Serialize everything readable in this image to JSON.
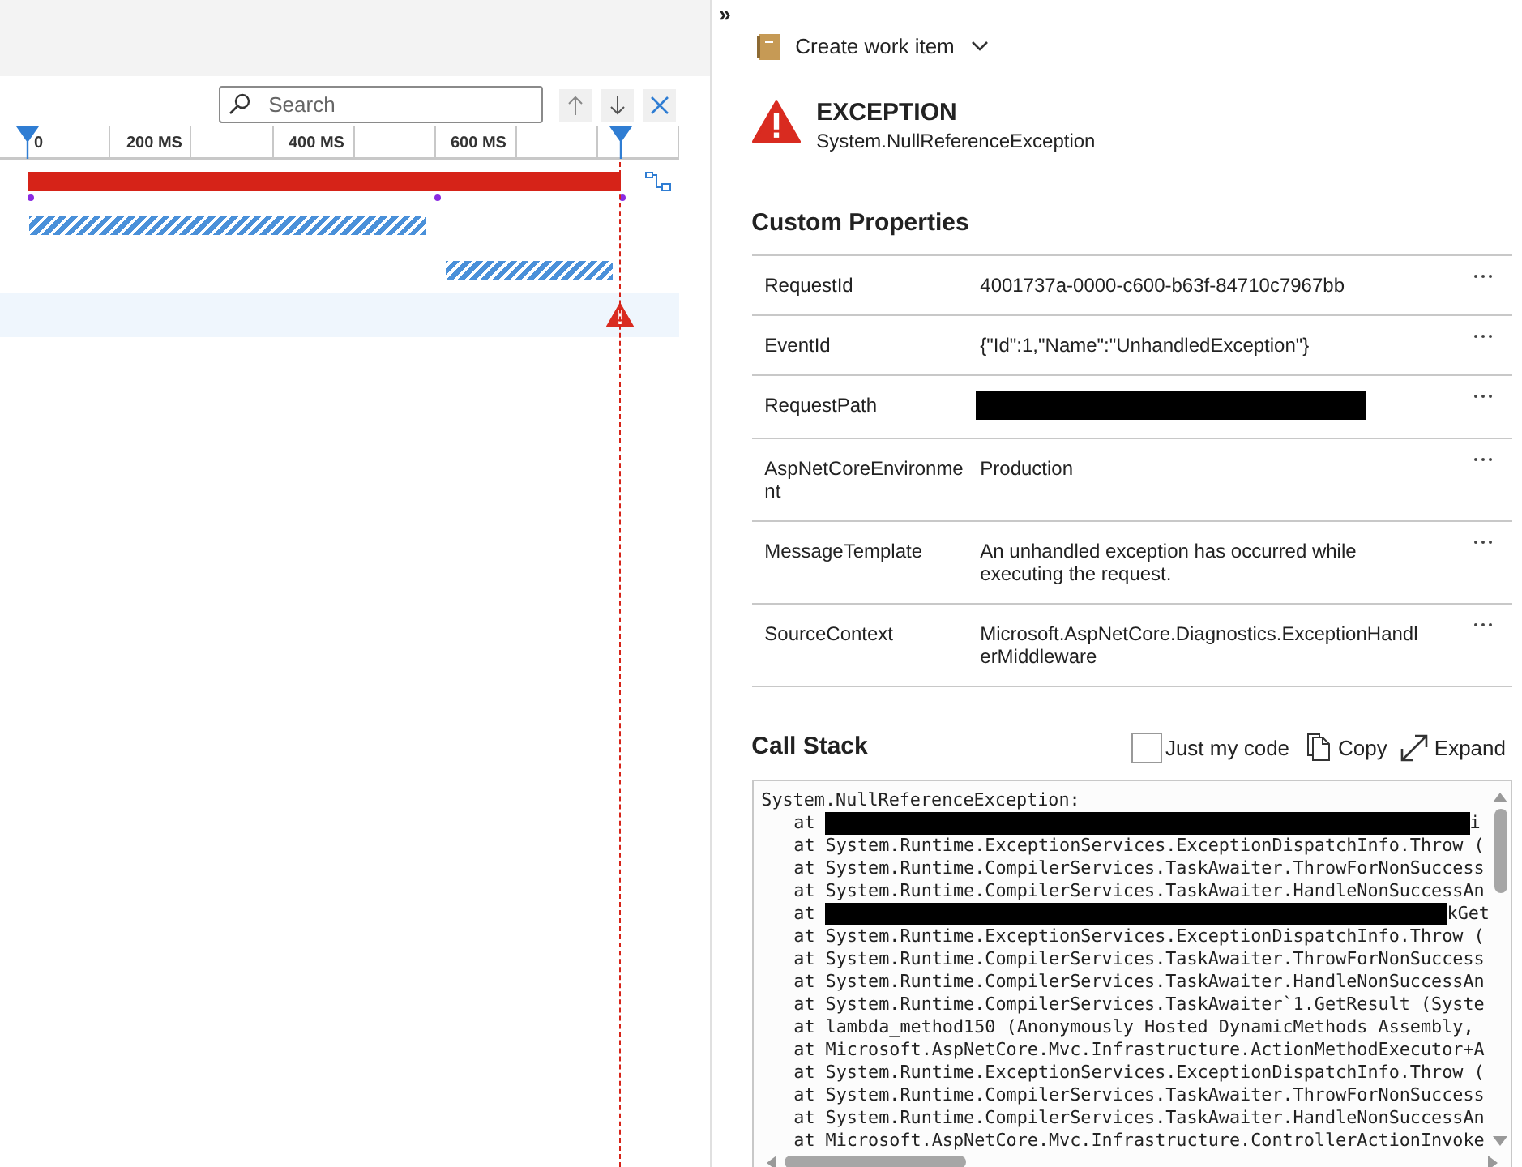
{
  "timeline": {
    "search": {
      "placeholder": "Search"
    },
    "ticks": [
      "0",
      "200 MS",
      "400 MS",
      "600 MS"
    ],
    "rows": [
      {
        "kind": "request",
        "selected": false
      },
      {
        "kind": "dependency",
        "selected": false
      },
      {
        "kind": "dependency",
        "selected": false
      },
      {
        "kind": "exception",
        "selected": true
      }
    ]
  },
  "details": {
    "collapse_glyph": "»",
    "create_work_item": "Create work item",
    "exception": {
      "title": "EXCEPTION",
      "type": "System.NullReferenceException"
    },
    "custom_properties": {
      "title": "Custom Properties",
      "rows": [
        {
          "key": "RequestId",
          "value": "4001737a-0000-c600-b63f-84710c7967bb"
        },
        {
          "key": "EventId",
          "value": "{\"Id\":1,\"Name\":\"UnhandledException\"}"
        },
        {
          "key": "RequestPath",
          "redacted": true
        },
        {
          "key": "AspNetCoreEnvironment",
          "value": "Production"
        },
        {
          "key": "MessageTemplate",
          "value": "An unhandled exception has occurred while executing the request."
        },
        {
          "key": "SourceContext",
          "value": "Microsoft.AspNetCore.Diagnostics.ExceptionHandlerMiddleware"
        }
      ]
    },
    "call_stack": {
      "title": "Call Stack",
      "just_my_code": {
        "label": "Just my code",
        "checked": false
      },
      "copy": "Copy",
      "expand": "Expand",
      "lines": [
        {
          "kind": "header",
          "text": "System.NullReferenceException:"
        },
        {
          "kind": "redacted",
          "before": "at",
          "after": "i"
        },
        {
          "kind": "frame",
          "text": "at System.Runtime.ExceptionServices.ExceptionDispatchInfo.Throw ("
        },
        {
          "kind": "frame",
          "text": "at System.Runtime.CompilerServices.TaskAwaiter.ThrowForNonSuccess"
        },
        {
          "kind": "frame",
          "text": "at System.Runtime.CompilerServices.TaskAwaiter.HandleNonSuccessAn"
        },
        {
          "kind": "redacted",
          "before": "at",
          "after": "kGet"
        },
        {
          "kind": "frame",
          "text": "at System.Runtime.ExceptionServices.ExceptionDispatchInfo.Throw ("
        },
        {
          "kind": "frame",
          "text": "at System.Runtime.CompilerServices.TaskAwaiter.ThrowForNonSuccess"
        },
        {
          "kind": "frame",
          "text": "at System.Runtime.CompilerServices.TaskAwaiter.HandleNonSuccessAn"
        },
        {
          "kind": "frame",
          "text": "at System.Runtime.CompilerServices.TaskAwaiter`1.GetResult (Syste"
        },
        {
          "kind": "frame",
          "text": "at lambda_method150 (Anonymously Hosted DynamicMethods Assembly,"
        },
        {
          "kind": "frame",
          "text": "at Microsoft.AspNetCore.Mvc.Infrastructure.ActionMethodExecutor+A"
        },
        {
          "kind": "frame",
          "text": "at System.Runtime.ExceptionServices.ExceptionDispatchInfo.Throw ("
        },
        {
          "kind": "frame",
          "text": "at System.Runtime.CompilerServices.TaskAwaiter.ThrowForNonSuccess"
        },
        {
          "kind": "frame",
          "text": "at System.Runtime.CompilerServices.TaskAwaiter.HandleNonSuccessAn"
        },
        {
          "kind": "frame",
          "text": "at Microsoft.AspNetCore.Mvc.Infrastructure.ControllerActionInvoke"
        }
      ]
    }
  }
}
